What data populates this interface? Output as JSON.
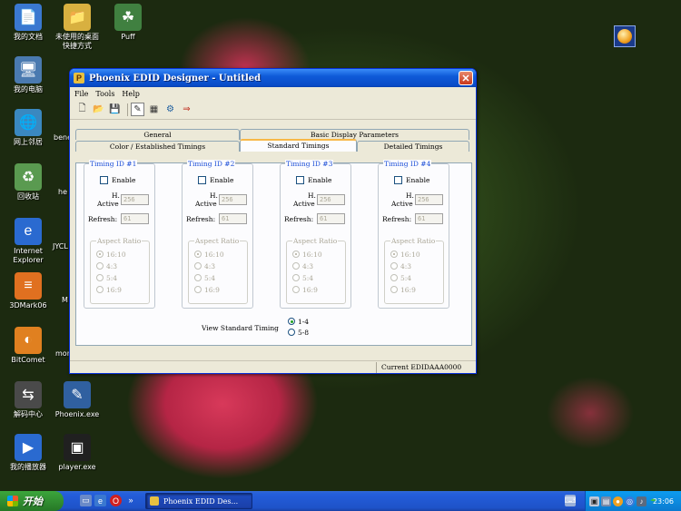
{
  "desktop": {
    "icons": [
      {
        "label1": "我的文档",
        "label2": "",
        "glyph": "📄",
        "color": "#3a78d0"
      },
      {
        "label1": "我的电脑",
        "label2": "",
        "glyph": "🖥",
        "color": "#4a7ab0"
      },
      {
        "label1": "网上邻居",
        "label2": "",
        "glyph": "🌐",
        "color": "#3a88c0"
      },
      {
        "label1": "回收站",
        "label2": "",
        "glyph": "♻",
        "color": "#5a9a50"
      },
      {
        "label1": "Internet",
        "label2": "Explorer",
        "glyph": "e",
        "color": "#2a6ad0"
      },
      {
        "label1": "3DMark06",
        "label2": "",
        "glyph": "≡",
        "color": "#e07020"
      },
      {
        "label1": "BitComet",
        "label2": "",
        "glyph": "◐",
        "color": "#e08020"
      },
      {
        "label1": "解码中心",
        "label2": "",
        "glyph": "⇆",
        "color": "#4a4a4a"
      },
      {
        "label1": "我的播放器",
        "label2": "",
        "glyph": "▶",
        "color": "#2a6ad0"
      },
      {
        "label1": "未使用的桌面",
        "label2": "快捷方式",
        "glyph": "📁",
        "color": "#d8b040"
      },
      {
        "label1": "Phoenix.exe",
        "label2": "",
        "glyph": "✎",
        "color": "#3060a0"
      },
      {
        "label1": "player.exe",
        "label2": "",
        "glyph": "▣",
        "color": "#202020"
      },
      {
        "label1": "Puff",
        "label2": "",
        "glyph": "☘",
        "color": "#408040"
      }
    ],
    "peek_labels": [
      "bene",
      "he",
      "JYCL",
      "M",
      "mon"
    ]
  },
  "window": {
    "title": "Phoenix EDID Designer - Untitled",
    "close": "✕",
    "menu": [
      "File",
      "Tools",
      "Help"
    ],
    "toolbar_icons": [
      "new-icon",
      "open-icon",
      "save-icon",
      "edit-icon",
      "grid-icon",
      "wizard-icon",
      "convert-icon"
    ],
    "tabs_back": [
      "General",
      "Basic Display Parameters"
    ],
    "tabs_front": [
      "Color /  Established Timings",
      "Standard Timings",
      "Detailed Timings"
    ],
    "selected_tab": "Standard Timings"
  },
  "timings": [
    {
      "title": "Timing ID #1",
      "enable": "Enable",
      "h_label": "H.",
      "active_label": "Active",
      "active": "256",
      "refresh_label": "Refresh:",
      "refresh": "61"
    },
    {
      "title": "Timing ID #2",
      "enable": "Enable",
      "h_label": "H.",
      "active_label": "Active",
      "active": "256",
      "refresh_label": "Refresh:",
      "refresh": "61"
    },
    {
      "title": "Timing ID #3",
      "enable": "Enable",
      "h_label": "H.",
      "active_label": "Active",
      "active": "256",
      "refresh_label": "Refresh:",
      "refresh": "61"
    },
    {
      "title": "Timing ID #4",
      "enable": "Enable",
      "h_label": "H.",
      "active_label": "Active",
      "active": "256",
      "refresh_label": "Refresh:",
      "refresh": "61"
    }
  ],
  "aspect": {
    "title": "Aspect Ratio",
    "options": [
      "16:10",
      "4:3",
      "5:4",
      "16:9"
    ],
    "selected": "16:10"
  },
  "view_standard": {
    "label": "View Standard Timing",
    "options": [
      "1-4",
      "5-8"
    ],
    "selected": "1-4"
  },
  "status": {
    "current": "Current EDIDAAA0000"
  },
  "taskbar": {
    "start": "开始",
    "task_label": "Phoenix EDID Des...",
    "clock": "23:06",
    "more": "»"
  }
}
